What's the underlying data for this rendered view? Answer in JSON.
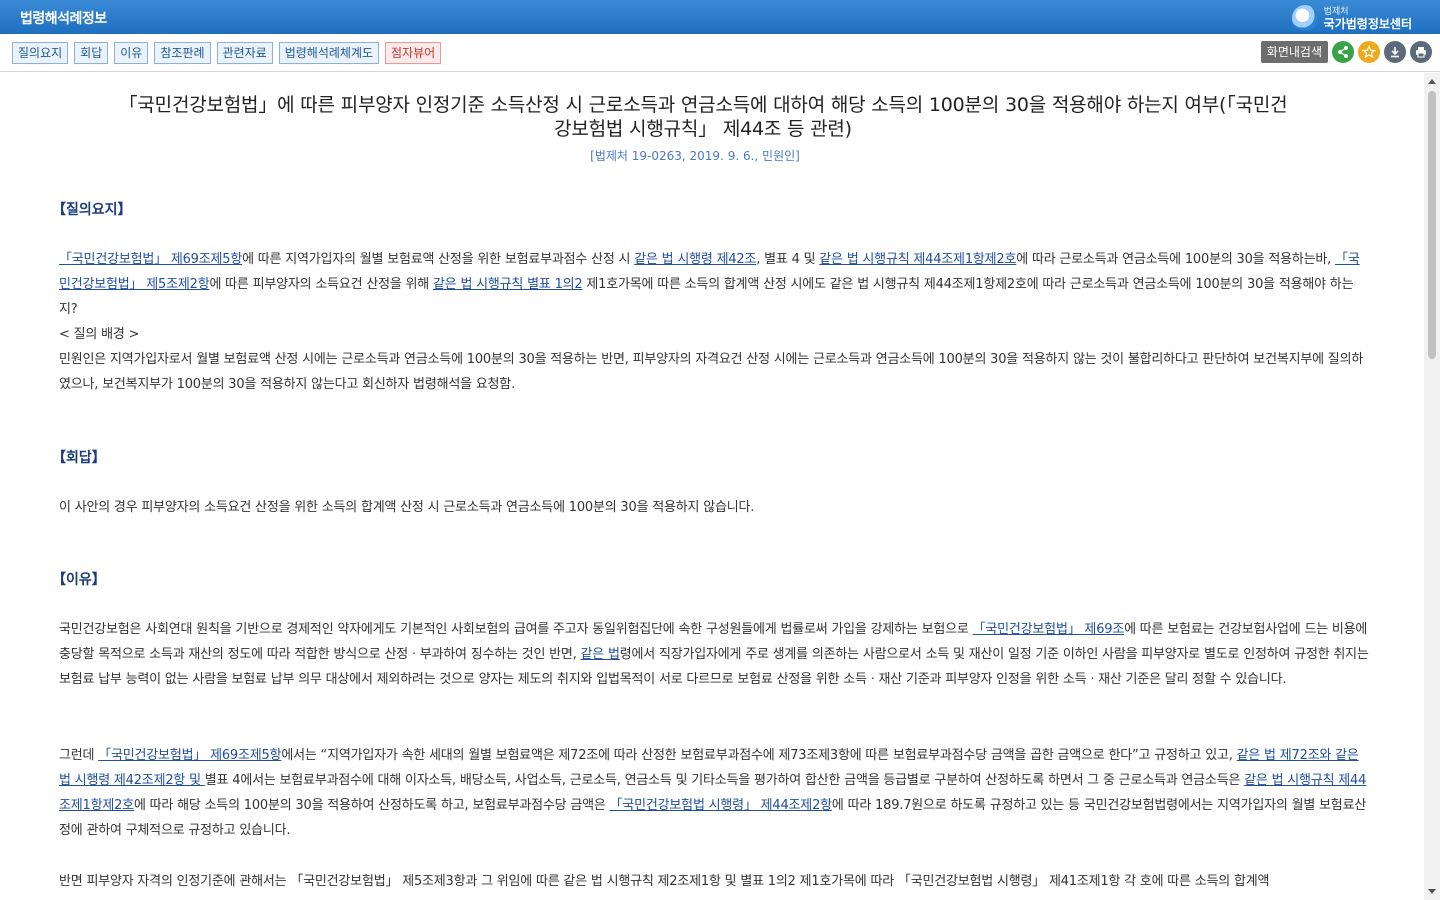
{
  "app": {
    "title": "법령해석례정보",
    "logo_small": "법제처",
    "logo_big": "국가법령정보센터"
  },
  "toolbar": {
    "tabs": [
      "질의요지",
      "회답",
      "이유",
      "참조판례",
      "관련자료",
      "법령해석례체계도",
      "점자뷰어"
    ],
    "search_label": "화면내검색",
    "icons": [
      "share-icon",
      "star-icon",
      "download-icon",
      "print-icon"
    ],
    "icon_colors": {
      "share": "#3aa34a",
      "star": "#f0a81c",
      "download": "#5b6b7b",
      "print": "#5b6b7b"
    }
  },
  "document": {
    "title_line1": "「국민건강보험법」에 따른 피부양자 인정기준 소득산정 시 근로소득과 연금소득에 대하여 해당 소득의 100분의 30을 적용해야 하는지 여부(「국민건",
    "title_line2": "강보험법 시행규칙」 제44조 등 관련)",
    "meta": "[법제처 19-0263, 2019. 9. 6., 민원인]",
    "sections": {
      "q_heading": "【질의요지】",
      "a_heading": "【회답】",
      "r_heading": "【이유】"
    },
    "q1": {
      "link1": "「국민건강보험법」 제69조제5항",
      "t1": "에 따른 지역가입자의 월별 보험료액 산정을 위한 보험료부과점수 산정 시 ",
      "link2": "같은 법 시행령 제42조",
      "t2": ", 별표 4 및 ",
      "link3": "같은 법 시행규칙 제44조제1항제2호",
      "t3": "에 따라 근로소득과 연금소득에 100분의 30을 적용하는바, ",
      "link4": "「국민건강보험법」 제5조제2항",
      "t4": "에 따른 피부양자의 소득요건 산정을 위해 ",
      "link5": "같은 법 시행규칙 별표 1의2",
      "t5": " 제1호가목에 따른 소득의 합계액 산정 시에도 같은 법 시행규칙 제44조제1항제2호에 따라 근로소득과 연금소득에 100분의 30을 적용해야 하는지?"
    },
    "q_bg_label": "< 질의 배경 >",
    "q_bg_text": "민원인은 지역가입자로서 월별 보험료액 산정 시에는 근로소득과 연금소득에 100분의 30을 적용하는 반면, 피부양자의 자격요건 산정 시에는 근로소득과 연금소득에 100분의 30을 적용하지 않는 것이 불합리하다고 판단하여 보건복지부에 질의하였으나, 보건복지부가 100분의 30을 적용하지 않는다고 회신하자 법령해석을 요청함.",
    "answer": "이 사안의 경우 피부양자의 소득요건 산정을 위한 소득의 합계액 산정 시 근로소득과 연금소득에 100분의 30을 적용하지 않습니다.",
    "r1": {
      "t1": "국민건강보험은 사회연대 원칙을 기반으로 경제적인 약자에게도 기본적인 사회보험의 급여를 주고자 동일위험집단에 속한 구성원들에게 법률로써 가입을 강제하는 보험으로 ",
      "link1": "「국민건강보험법」 제69조",
      "t2": "에 따른 보험료는 건강보험사업에 드는 비용에 충당할 목적으로 소득과 재산의 정도에 따라 적합한 방식으로 산정ㆍ부과하여 징수하는 것인 반면, ",
      "link2": "같은 법",
      "t3": "령에서 직장가입자에게 주로 생계를 의존하는 사람으로서 소득 및 재산이 일정 기준 이하인 사람을 피부양자로 별도로 인정하여 규정한 취지는 보험료 납부 능력이 없는 사람을 보험료 납부 의무 대상에서 제외하려는 것으로 양자는 제도의 취지와 입법목적이 서로 다르므로 보험료 산정을 위한 소득ㆍ재산 기준과 피부양자 인정을 위한 소득ㆍ재산 기준은 달리 정할 수 있습니다."
    },
    "r2": {
      "t1": "그런데 ",
      "link1": "「국민건강보험법」 제69조제5항",
      "t2": "에서는 “지역가입자가 속한 세대의 월별 보험료액은 제72조에 따라 산정한 보험료부과점수에 제73조제3항에 따른 보험료부과점수당 금액을 곱한 금액으로 한다”고 규정하고 있고, ",
      "link2": "같은 법 제72조와 같은 법 시행령 제42조제2항 및 ",
      "t3": "별표 4에서는 보험료부과점수에 대해 이자소득, 배당소득, 사업소득, 근로소득, 연금소득 및 기타소득을 평가하여 합산한 금액을 등급별로 구분하여 산정하도록 하면서 그 중 근로소득과 연금소득은 ",
      "link3": "같은 법 시행규칙 제44조제1항제2호",
      "t4": "에 따라 해당 소득의 100분의 30을 적용하여 산정하도록 하고, 보험료부과점수당 금액은 ",
      "link4": "「국민건강보험법 시행령」 제44조제2항",
      "t5": "에 따라 189.7원으로 하도록 규정하고 있는 등 국민건강보험법령에서는 지역가입자의 월별 보험료산정에 관하여 구체적으로 규정하고 있습니다."
    },
    "r3_partial": "반면 피부양자 자격의 인정기준에 관해서는 「국민건강보험법」 제5조제3항과 그 위임에 따른 같은 법 시행규칙 제2조제1항 및 별표 1의2 제1호가목에 따라 「국민건강보험법 시행령」 제41조제1항 각 호에 따른 소득의 합계액"
  }
}
